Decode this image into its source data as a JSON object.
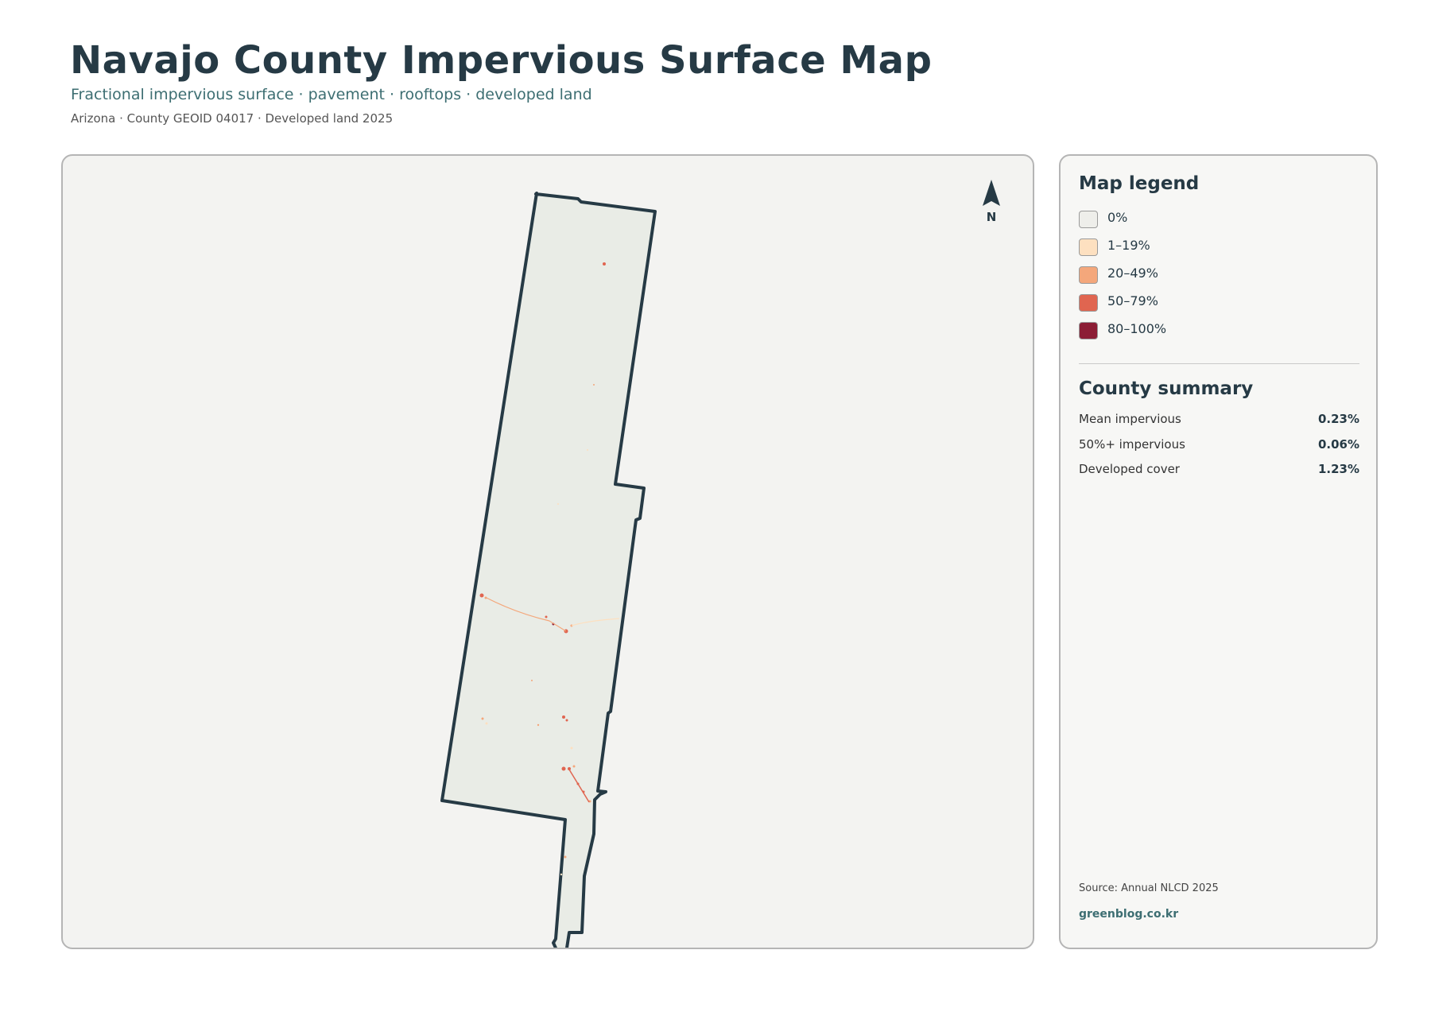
{
  "header": {
    "title": "Navajo County Impervious Surface Map",
    "subtitle": "Fractional impervious surface · pavement · rooftops · developed land",
    "meta": "Arizona · County GEOID 04017 · Developed land 2025"
  },
  "map": {
    "north_label": "N",
    "county_fill": "#e9ece6",
    "county_outline": "#263a45"
  },
  "legend": {
    "title": "Map legend",
    "items": [
      {
        "label": "0%",
        "color": "#eeeeea"
      },
      {
        "label": "1–19%",
        "color": "#fde0c0"
      },
      {
        "label": "20–49%",
        "color": "#f4a77b"
      },
      {
        "label": "50–79%",
        "color": "#e06550"
      },
      {
        "label": "80–100%",
        "color": "#8c1d35"
      }
    ]
  },
  "summary": {
    "title": "County summary",
    "rows": [
      {
        "label": "Mean impervious",
        "value": "0.23%"
      },
      {
        "label": "50%+ impervious",
        "value": "0.06%"
      },
      {
        "label": "Developed cover",
        "value": "1.23%"
      }
    ]
  },
  "footer": {
    "source": "Source: Annual NLCD 2025",
    "site": "greenblog.co.kr"
  }
}
